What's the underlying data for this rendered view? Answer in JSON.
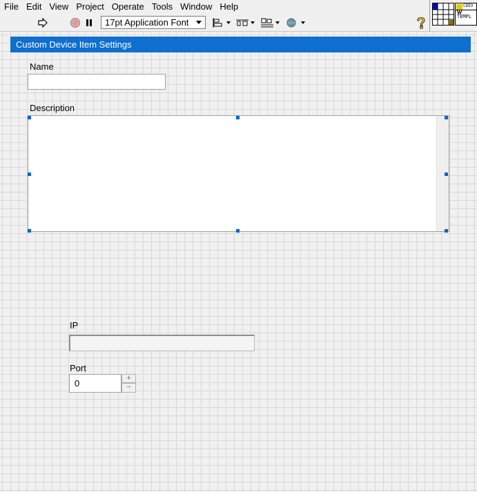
{
  "menu": {
    "items": [
      {
        "label": "File"
      },
      {
        "label": "Edit"
      },
      {
        "label": "View"
      },
      {
        "label": "Project"
      },
      {
        "label": "Operate"
      },
      {
        "label": "Tools"
      },
      {
        "label": "Window"
      },
      {
        "label": "Help"
      }
    ]
  },
  "toolbar": {
    "font_selector": "17pt Application Font",
    "icons": [
      "run-arrow-icon",
      "abort-icon",
      "pause-icon",
      "align-icon",
      "distribute-icon",
      "resize-icon",
      "reorder-icon",
      "help-icon"
    ]
  },
  "vi_icon": {
    "line1": "CDEV",
    "line2": "TEMPL"
  },
  "panel": {
    "header": "Custom Device Item Settings",
    "name_label": "Name",
    "name_value": "",
    "description_label": "Description",
    "description_value": "",
    "ip_label": "IP",
    "ip_value": "",
    "port_label": "Port",
    "port_value": "0",
    "port_inc": "+",
    "port_dec": "−"
  },
  "colors": {
    "header_bg": "#0f6fcf",
    "selection_handle": "#0066cc",
    "help_icon": "#e0b800"
  }
}
